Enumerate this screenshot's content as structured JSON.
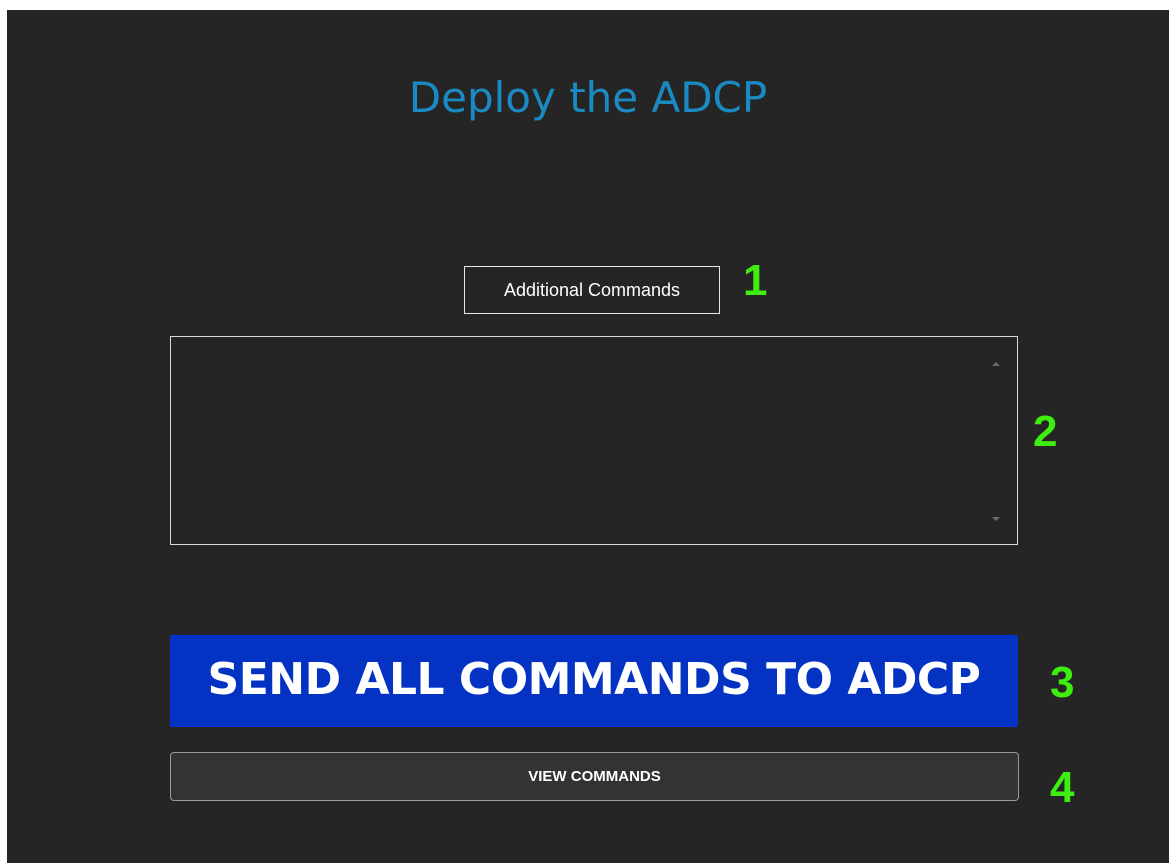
{
  "page": {
    "title": "Deploy the ADCP"
  },
  "commands": {
    "label": "Additional Commands",
    "text_value": ""
  },
  "buttons": {
    "send_all_label": "SEND ALL COMMANDS TO ADCP",
    "view_commands_label": "VIEW COMMANDS"
  },
  "markers": {
    "one": "1",
    "two": "2",
    "three": "3",
    "four": "4"
  },
  "colors": {
    "background": "#252525",
    "title": "#1b8ac2",
    "send_button": "#0433c4",
    "marker": "#3dee10"
  },
  "icons": {
    "scroll_up": "scroll-up-arrow-icon",
    "scroll_down": "scroll-down-arrow-icon"
  }
}
